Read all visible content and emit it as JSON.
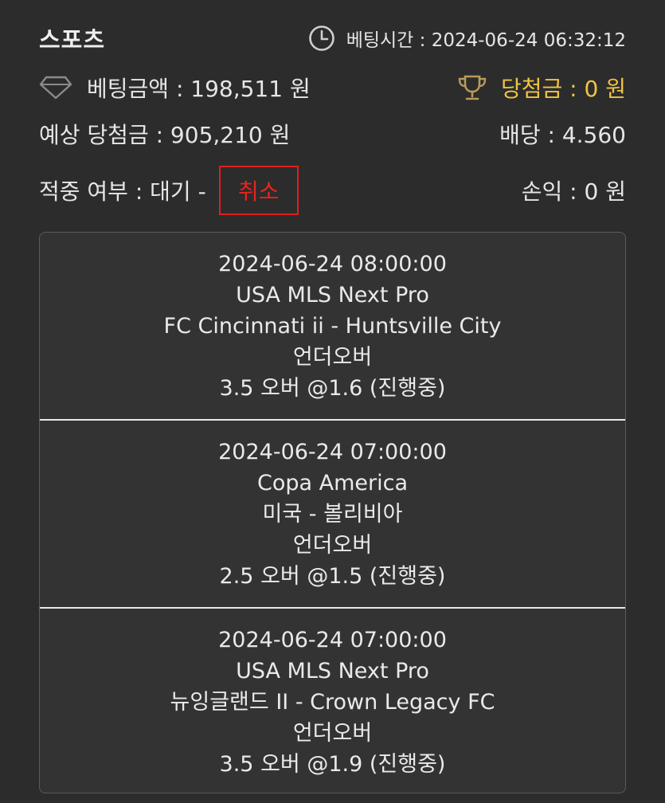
{
  "header": {
    "title": "스포츠",
    "bet_time": "베팅시간 : 2024-06-24 06:32:12"
  },
  "summary": {
    "bet_amount": "베팅금액 : 198,511 원",
    "win_amount": "당첨금 : 0 원",
    "expected_win": "예상 당첨금 : 905,210 원",
    "odds": "배당 : 4.560",
    "result_status": "적중 여부 : 대기 -",
    "cancel_label": "취소",
    "profit": "손익 : 0 원"
  },
  "matches": [
    {
      "datetime": "2024-06-24 08:00:00",
      "league": "USA MLS Next Pro",
      "teams": "FC Cincinnati ii - Huntsville City",
      "market": "언더오버",
      "pick": "3.5 오버 @1.6 (진행중)"
    },
    {
      "datetime": "2024-06-24 07:00:00",
      "league": "Copa America",
      "teams": "미국 - 볼리비아",
      "market": "언더오버",
      "pick": "2.5 오버 @1.5 (진행중)"
    },
    {
      "datetime": "2024-06-24 07:00:00",
      "league": "USA MLS Next Pro",
      "teams": "뉴잉글랜드 II - Crown Legacy FC",
      "market": "언더오버",
      "pick": "3.5 오버 @1.9 (진행중)"
    }
  ],
  "colors": {
    "background": "#2c2c2c",
    "gold": "#f0c341",
    "cancel_red": "#e01e1e"
  },
  "icons": [
    "clock-icon",
    "diamond-icon",
    "trophy-icon"
  ]
}
